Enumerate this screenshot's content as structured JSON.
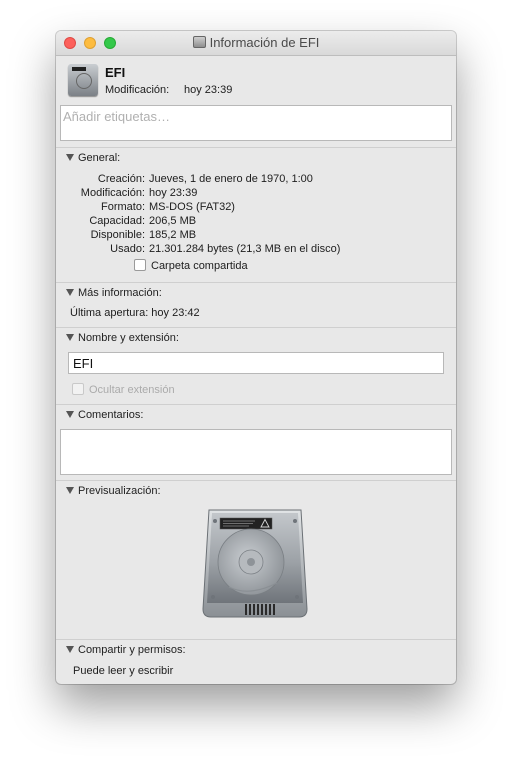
{
  "window": {
    "title": "Información de EFI",
    "title_icon": "drive-icon"
  },
  "header": {
    "name": "EFI",
    "modified_label": "Modificación:",
    "modified_value": "hoy 23:39",
    "icon": "drive-icon"
  },
  "tags": {
    "placeholder": "Añadir etiquetas…",
    "value": ""
  },
  "sections": {
    "general": {
      "title": "General:",
      "rows": [
        {
          "label": "Creación:",
          "value": "Jueves, 1 de enero de 1970, 1:00"
        },
        {
          "label": "Modificación:",
          "value": "hoy 23:39"
        },
        {
          "label": "Formato:",
          "value": "MS-DOS (FAT32)"
        },
        {
          "label": "Capacidad:",
          "value": "206,5 MB"
        },
        {
          "label": "Disponible:",
          "value": "185,2 MB"
        },
        {
          "label": "Usado:",
          "value": "21.301.284 bytes (21,3 MB en el disco)"
        }
      ],
      "shared_folder": {
        "label": "Carpeta compartida",
        "checked": false
      }
    },
    "more_info": {
      "title": "Más información:",
      "last_opened": "Última apertura: hoy 23:42"
    },
    "name_ext": {
      "title": "Nombre y extensión:",
      "value": "EFI",
      "hide_extension": {
        "label": "Ocultar extensión",
        "checked": false,
        "disabled": true
      }
    },
    "comments": {
      "title": "Comentarios:",
      "value": ""
    },
    "preview": {
      "title": "Previsualización:",
      "icon": "hard-drive-icon"
    },
    "sharing": {
      "title": "Compartir y permisos:",
      "summary": "Puede leer y escribir"
    }
  },
  "colors": {
    "close": "#fc605b",
    "minimize": "#fdbc40",
    "maximize": "#34c84a",
    "window_bg": "#e8e8e8"
  }
}
